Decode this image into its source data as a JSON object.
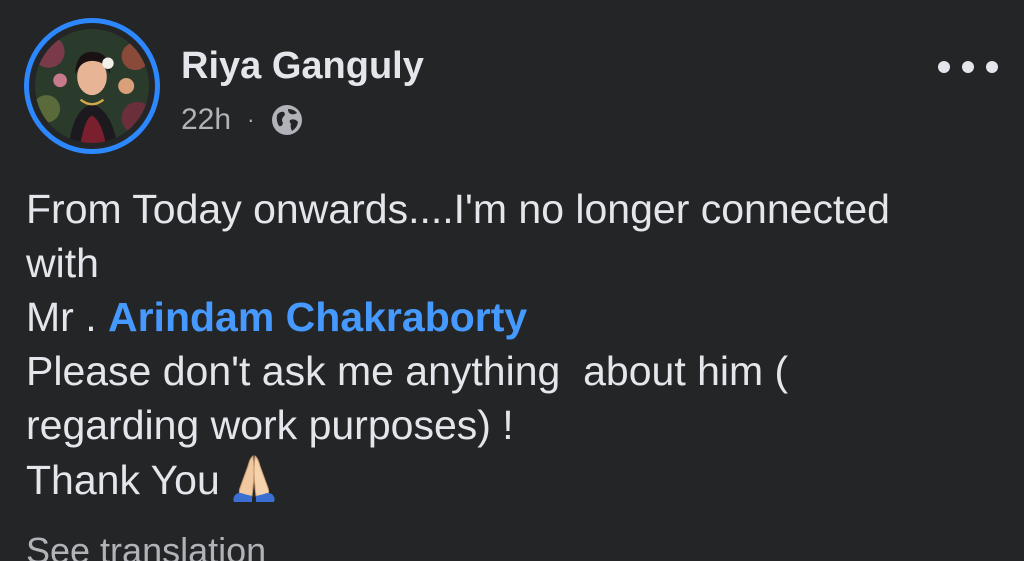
{
  "post": {
    "author": {
      "name": "Riya Ganguly",
      "avatar_icon": "profile-photo"
    },
    "meta": {
      "time": "22h",
      "separator": "·",
      "privacy_icon": "globe-icon"
    },
    "more_icon": "more-options-icon",
    "text": {
      "line1": "From Today onwards....I'm no longer connected",
      "line2": "with",
      "line3_prefix": "Mr . ",
      "mention": "Arindam Chakraborty",
      "line4": "Please don't ask me anything  about him (",
      "line5": "regarding work purposes) !",
      "line6": "Thank You",
      "emoji_icon": "folded-hands-emoji"
    },
    "see_translation": "See translation"
  },
  "colors": {
    "background": "#242526",
    "primary_text": "#e4e6eb",
    "secondary_text": "#b0b3b8",
    "avatar_ring": "#2d88ff",
    "mention": "#4599ff"
  }
}
